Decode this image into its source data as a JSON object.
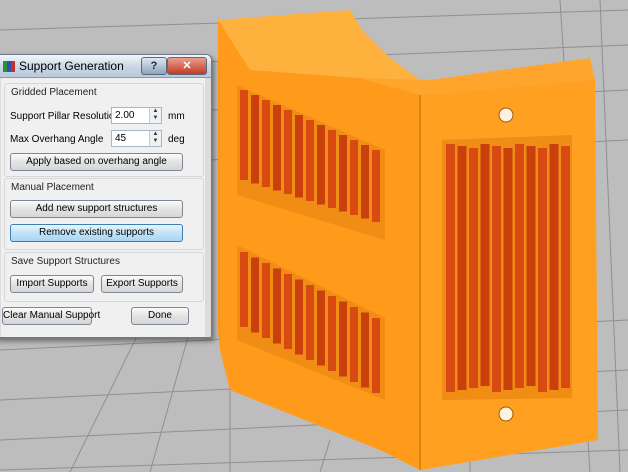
{
  "dialog": {
    "title": "Support Generation",
    "help_label": "?",
    "close_label": "✕"
  },
  "gridded": {
    "title": "Gridded Placement",
    "resolution_label": "Support Pillar Resolution",
    "resolution_value": "2.00",
    "resolution_unit": "mm",
    "angle_label": "Max Overhang Angle",
    "angle_value": "45",
    "angle_unit": "deg",
    "apply_label": "Apply based on overhang angle"
  },
  "manual": {
    "title": "Manual Placement",
    "add_label": "Add new support structures",
    "remove_label": "Remove existing supports"
  },
  "save": {
    "title": "Save Support Structures",
    "import_label": "Import Supports",
    "export_label": "Export Supports"
  },
  "footer": {
    "clear_label": "Clear Manual Support",
    "done_label": "Done"
  },
  "colors": {
    "model_orange": "#ff9a1a",
    "support_red": "#d84a12",
    "floor_gray": "#b9b9b9"
  }
}
